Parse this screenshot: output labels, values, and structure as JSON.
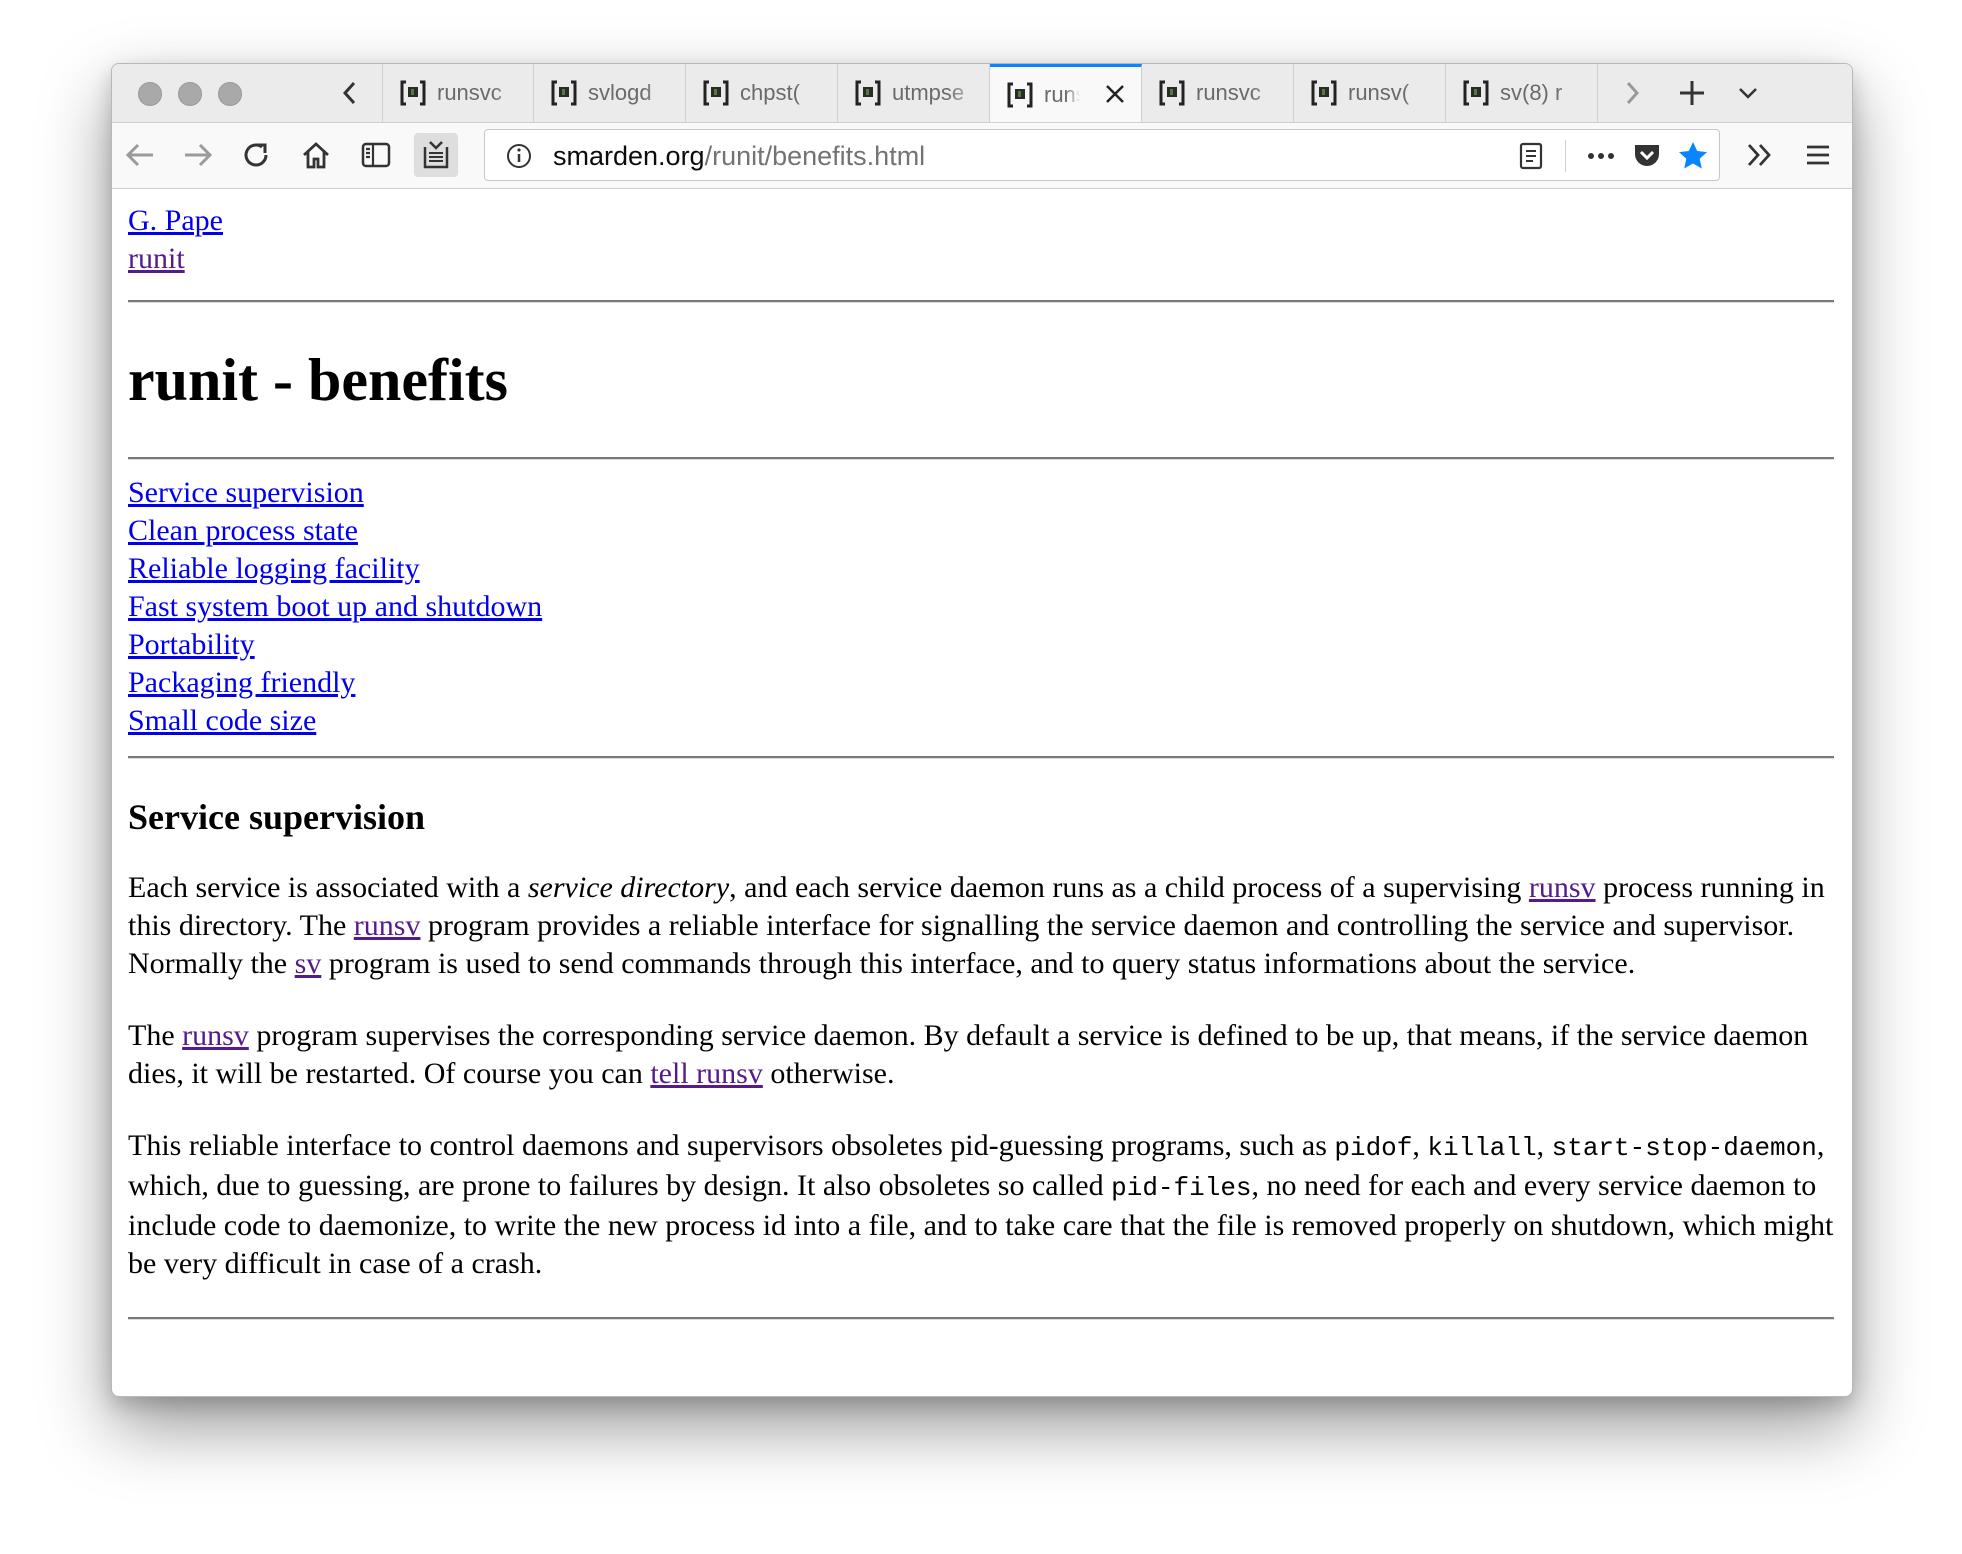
{
  "browser": {
    "tabs": [
      {
        "label": "runsvc"
      },
      {
        "label": "svlogd"
      },
      {
        "label": "chpst("
      },
      {
        "label": "utmpse"
      },
      {
        "label": "runsvdir",
        "active": true
      },
      {
        "label": "runsvc"
      },
      {
        "label": "runsv("
      },
      {
        "label": "sv(8) r"
      }
    ],
    "url_domain": "smarden.org",
    "url_path": "/runit/benefits.html",
    "accent_color": "#0a84ff",
    "icons": [
      "back-icon",
      "forward-icon",
      "reload-icon",
      "home-icon",
      "sidebar-icon",
      "screenshot-icon",
      "info-icon",
      "reader-view-icon",
      "page-actions-icon",
      "pocket-icon",
      "bookmark-star-icon",
      "overflow-icon",
      "menu-icon",
      "new-tab-icon",
      "tab-list-icon"
    ]
  },
  "page": {
    "top_links": [
      "G. Pape",
      "runit"
    ],
    "title": "runit - benefits",
    "toc": [
      "Service supervision",
      "Clean process state",
      "Reliable logging facility",
      "Fast system boot up and shutdown",
      "Portability",
      "Packaging friendly",
      "Small code size"
    ],
    "section_heading": "Service supervision",
    "p1": {
      "t1": "Each service is associated with a ",
      "em": "service directory",
      "t2": ", and each service daemon runs as a child process of a supervising ",
      "link1": "runsv",
      "t3": " process running in this directory. The ",
      "link2": "runsv",
      "t4": " program provides a reliable interface for signalling the service daemon and controlling the service and supervisor. Normally the ",
      "link3": "sv",
      "t5": " program is used to send commands through this interface, and to query status informations about the service."
    },
    "p2": {
      "t1": "The ",
      "link1": "runsv",
      "t2": " program supervises the corresponding service daemon. By default a service is defined to be up, that means, if the service daemon dies, it will be restarted. Of course you can ",
      "link2": "tell runsv",
      "t3": " otherwise."
    },
    "p3": {
      "t1": "This reliable interface to control daemons and supervisors obsoletes pid-guessing programs, such as ",
      "c1": "pidof",
      "t2": ", ",
      "c2": "killall",
      "t3": ", ",
      "c3": "start-stop-daemon",
      "t4": ", which, due to guessing, are prone to failures by design. It also obsoletes so called ",
      "c4": "pid-files",
      "t5": ", no need for each and every service daemon to include code to daemonize, to write the new process id into a file, and to take care that the file is removed properly on shutdown, which might be very difficult in case of a crash."
    }
  }
}
